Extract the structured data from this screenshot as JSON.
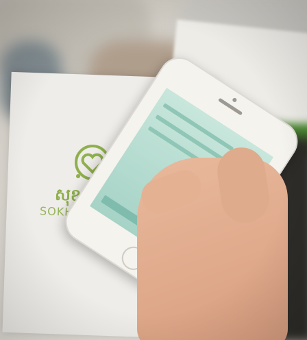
{
  "brochure": {
    "khmer_title": "សុខក្រម",
    "brand": "SOKHAKRO"
  },
  "colors": {
    "brand_green": "#8fb04d",
    "screen": "#b8dcd1"
  },
  "icons": {
    "logo": "heart-map-pin-icon"
  }
}
